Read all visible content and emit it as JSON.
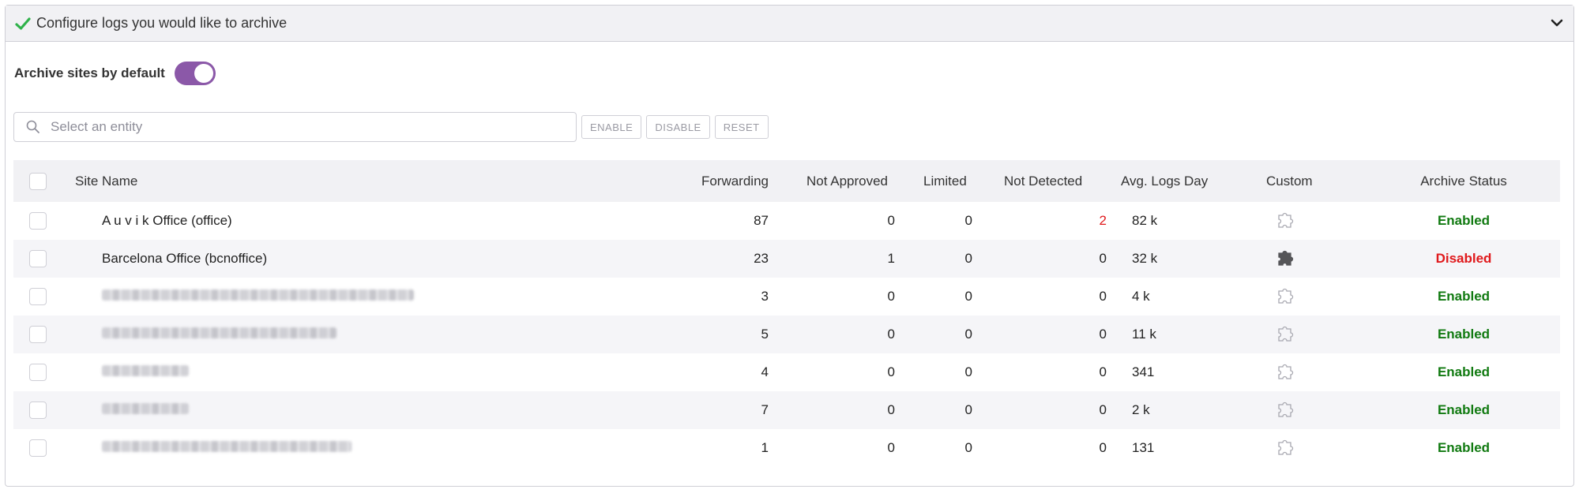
{
  "panel": {
    "title": "Configure logs you would like to archive",
    "icons": {
      "check": "check-icon",
      "collapse": "chevron-down-icon"
    },
    "accent_check_color": "#2fb24a"
  },
  "archive_default": {
    "label": "Archive sites by default",
    "enabled": true,
    "toggle_color": "#8b58a8"
  },
  "search": {
    "placeholder": "Select an entity",
    "value": ""
  },
  "toolbar": {
    "enable_label": "ENABLE",
    "disable_label": "DISABLE",
    "reset_label": "RESET"
  },
  "table": {
    "headers": {
      "site_name": "Site Name",
      "forwarding": "Forwarding",
      "not_approved": "Not Approved",
      "limited": "Limited",
      "not_detected": "Not Detected",
      "avg_logs_day": "Avg. Logs Day",
      "custom": "Custom",
      "archive_status": "Archive Status"
    },
    "rows": [
      {
        "name": "A u v i k Office (office)",
        "forwarding": "87",
        "not_approved": "0",
        "limited": "0",
        "not_detected": "2",
        "avg": "82 k",
        "custom": "puzzle-outline-icon",
        "status": "Enabled"
      },
      {
        "name": "Barcelona Office (bcnoffice)",
        "forwarding": "23",
        "not_approved": "1",
        "limited": "0",
        "not_detected": "0",
        "avg": "32 k",
        "custom": "puzzle-filled-icon",
        "status": "Disabled"
      },
      {
        "name": "",
        "forwarding": "3",
        "not_approved": "0",
        "limited": "0",
        "not_detected": "0",
        "avg": "4 k",
        "custom": "puzzle-outline-icon",
        "status": "Enabled"
      },
      {
        "name": "",
        "forwarding": "5",
        "not_approved": "0",
        "limited": "0",
        "not_detected": "0",
        "avg": "11 k",
        "custom": "puzzle-outline-icon",
        "status": "Enabled"
      },
      {
        "name": "",
        "forwarding": "4",
        "not_approved": "0",
        "limited": "0",
        "not_detected": "0",
        "avg": "341",
        "custom": "puzzle-outline-icon",
        "status": "Enabled"
      },
      {
        "name": "",
        "forwarding": "7",
        "not_approved": "0",
        "limited": "0",
        "not_detected": "0",
        "avg": "2 k",
        "custom": "puzzle-outline-icon",
        "status": "Enabled"
      },
      {
        "name": "",
        "forwarding": "1",
        "not_approved": "0",
        "limited": "0",
        "not_detected": "0",
        "avg": "131",
        "custom": "puzzle-outline-icon",
        "status": "Enabled"
      }
    ]
  },
  "colors": {
    "enabled": "#117a11",
    "disabled": "#e0191c",
    "alert_value": "#e0191c"
  }
}
